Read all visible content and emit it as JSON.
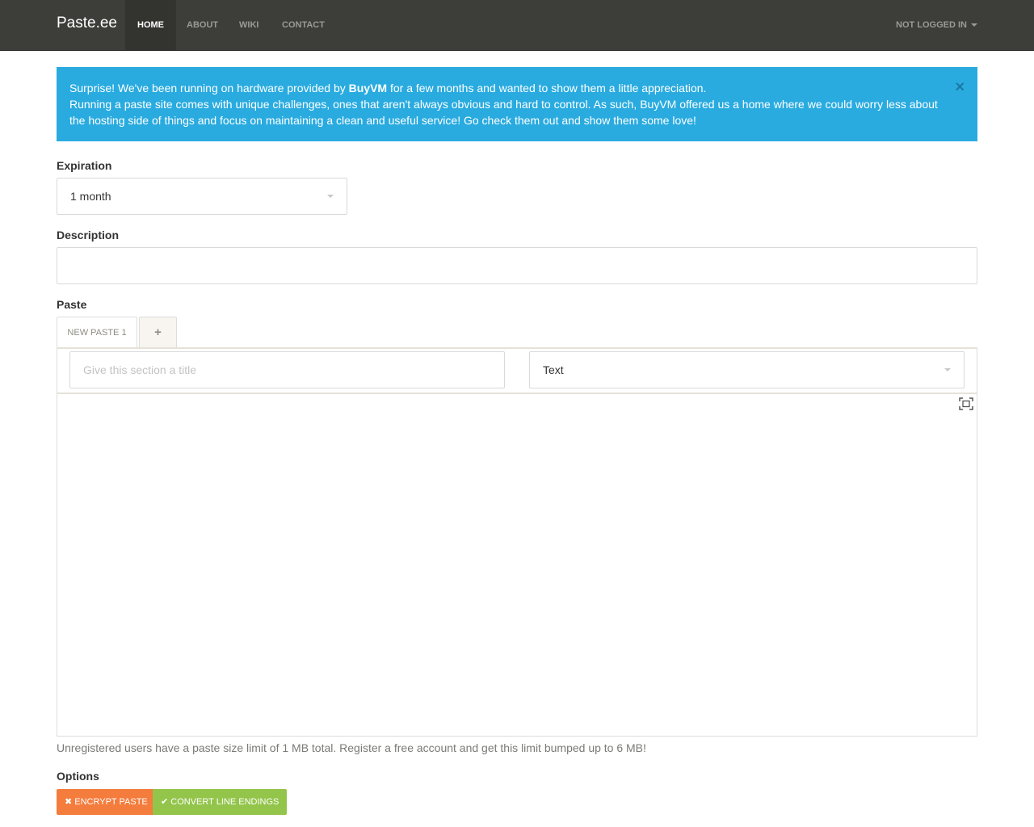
{
  "navbar": {
    "brand": "Paste.ee",
    "items": [
      {
        "label": "HOME",
        "active": true
      },
      {
        "label": "ABOUT"
      },
      {
        "label": "WIKI"
      },
      {
        "label": "CONTACT"
      }
    ],
    "user_menu": "NOT LOGGED IN"
  },
  "alert": {
    "line1_before": "Surprise! We've been running on hardware provided by ",
    "line1_bold": "BuyVM",
    "line1_after": " for a few months and wanted to show them a little appreciation.",
    "line2": "Running a paste site comes with unique challenges, ones that aren't always obvious and hard to control. As such, BuyVM offered us a home where we could worry less about the hosting side of things and focus on maintaining a clean and useful service! Go check them out and show them some love!",
    "close": "×"
  },
  "form": {
    "expiration_label": "Expiration",
    "expiration_value": "1 month",
    "description_label": "Description",
    "description_value": "",
    "paste_label": "Paste",
    "tabs": [
      {
        "label": "NEW PASTE 1",
        "active": true
      },
      {
        "label": "+",
        "icon": "plus-icon"
      }
    ],
    "section_title_placeholder": "Give this section a title",
    "syntax_value": "Text",
    "help_text": "Unregistered users have a paste size limit of 1 MB total. Register a free account and get this limit bumped up to 6 MB!",
    "options_label": "Options",
    "encrypt_button": "ENCRYPT PASTE",
    "convert_button": "CONVERT LINE ENDINGS"
  },
  "icons": {
    "fullscreen": "fullscreen-icon",
    "encrypt": "times-icon",
    "convert": "check-icon"
  },
  "colors": {
    "navbar": "#3d3d3a",
    "alert": "#29abe0",
    "encrypt": "#f47c3c",
    "convert": "#93c54b"
  }
}
